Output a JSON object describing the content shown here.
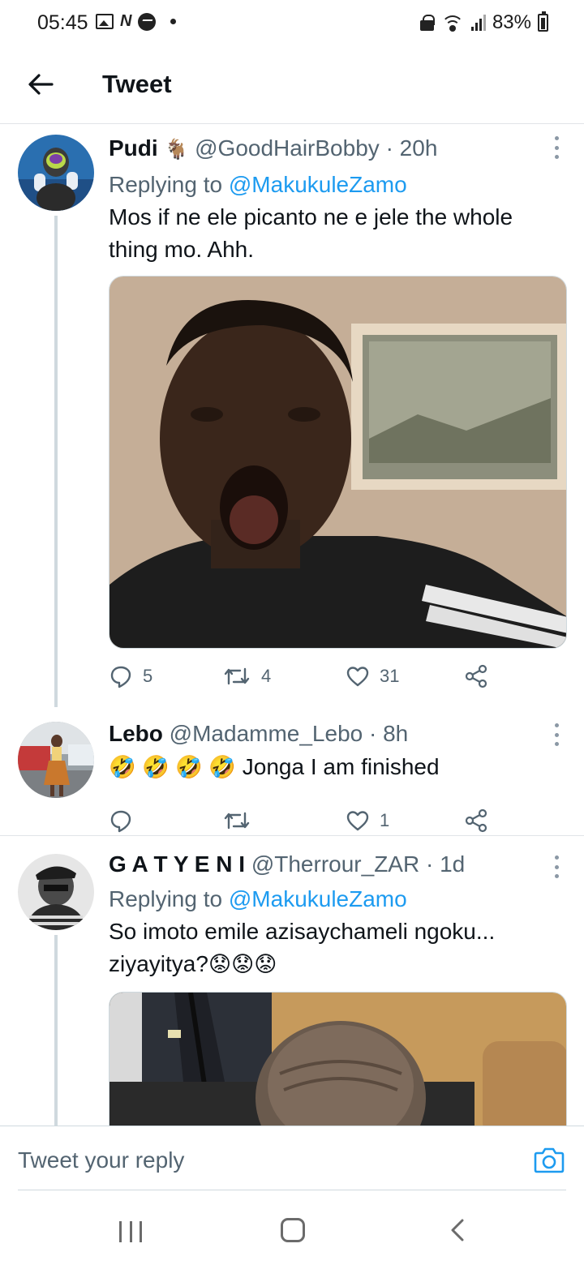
{
  "status_bar": {
    "time": "05:45",
    "left_icons": [
      "gallery-icon",
      "n-icon",
      "messenger-icon",
      "dot-icon"
    ],
    "right_icons": [
      "lock-icon",
      "wifi-icon",
      "signal-icon",
      "battery-icon"
    ],
    "battery_percent": "83%"
  },
  "header": {
    "back_icon": "back-arrow-icon",
    "title": "Tweet"
  },
  "colors": {
    "accent": "#1d9bf0",
    "text_primary": "#0f1419",
    "text_secondary": "#536471",
    "thread_line": "#cfd9de"
  },
  "tweets": [
    {
      "name": "Pudi",
      "badge": "🐐",
      "handle": "@GoodHairBobby",
      "separator": "·",
      "time": "20h",
      "replying_prefix": "Replying to",
      "replying_to": "@MakukuleZamo",
      "text": "Mos if ne ele picanto ne e jele the whole thing mo. Ahh.",
      "has_media": true,
      "stats": {
        "replies": "5",
        "retweets": "4",
        "likes": "31"
      }
    },
    {
      "name": "Lebo",
      "handle": "@Madamme_Lebo",
      "separator": "·",
      "time": "8h",
      "emojis": "🤣 🤣 🤣 🤣",
      "text": "Jonga I am finished",
      "has_media": false,
      "stats": {
        "replies": "",
        "retweets": "",
        "likes": "1"
      }
    },
    {
      "name": "G A T Y E N I",
      "handle": "@Therrour_ZAR",
      "separator": "·",
      "time": "1d",
      "replying_prefix": "Replying to",
      "replying_to": "@MakukuleZamo",
      "text_line1": "So imoto emile azisaychameli ngoku...",
      "text_line2": "ziyayitya?",
      "emojis": "😟😟😟",
      "has_media": true
    }
  ],
  "reply_bar": {
    "placeholder": "Tweet your reply",
    "camera_icon": "camera-icon"
  },
  "nav_bar": {
    "icons": [
      "recent-apps-icon",
      "home-icon",
      "back-icon"
    ]
  }
}
